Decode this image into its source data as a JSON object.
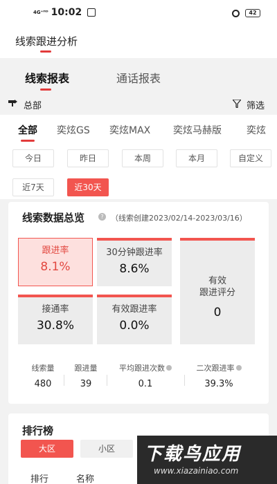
{
  "status_bar": {
    "signal": "4G⁺ᴴᴰ",
    "time": "10:02",
    "battery": "42"
  },
  "app": {
    "title": "线索跟进分析"
  },
  "tabs": [
    {
      "label": "线索报表",
      "active": true
    },
    {
      "label": "通话报表",
      "active": false
    }
  ],
  "filter_bar": {
    "region": "总部",
    "filter_label": "筛选"
  },
  "models": [
    {
      "label": "全部",
      "active": true
    },
    {
      "label": "奕炫GS",
      "active": false
    },
    {
      "label": "奕炫MAX",
      "active": false
    },
    {
      "label": "奕炫马赫版",
      "active": false
    },
    {
      "label": "奕炫",
      "active": false
    }
  ],
  "date_ranges": [
    {
      "label": "今日",
      "active": false
    },
    {
      "label": "昨日",
      "active": false
    },
    {
      "label": "本周",
      "active": false
    },
    {
      "label": "本月",
      "active": false
    },
    {
      "label": "自定义",
      "active": false
    },
    {
      "label": "近7天",
      "active": false
    },
    {
      "label": "近30天",
      "active": true
    }
  ],
  "overview": {
    "title": "线索数据总览",
    "subtitle": "（线索创建2023/02/14-2023/03/16）",
    "metrics": [
      {
        "label": "跟进率",
        "value": "8.1%",
        "selected": true
      },
      {
        "label": "30分钟跟进率",
        "value": "8.6%",
        "selected": false
      },
      {
        "label": "接通率",
        "value": "30.8%",
        "selected": false
      },
      {
        "label": "有效跟进率",
        "value": "0.0%",
        "selected": false
      }
    ],
    "score": {
      "label_line1": "有效",
      "label_line2": "跟进评分",
      "value": "0"
    },
    "stats": [
      {
        "label": "线索量",
        "value": "480"
      },
      {
        "label": "跟进量",
        "value": "39"
      },
      {
        "label": "平均跟进次数",
        "value": "0.1"
      },
      {
        "label": "二次跟进率",
        "value": "39.3%"
      }
    ]
  },
  "ranking": {
    "title": "排行榜",
    "chips": [
      {
        "label": "大区",
        "active": true
      },
      {
        "label": "小区",
        "active": false
      }
    ],
    "columns": [
      "排行",
      "名称"
    ]
  },
  "watermark": {
    "text": "下载鸟应用",
    "url": "www.xiazainiao.com"
  },
  "colors": {
    "accent": "#f2554f",
    "accent_dark": "#e23b3b",
    "background": "#f2f2f2"
  }
}
